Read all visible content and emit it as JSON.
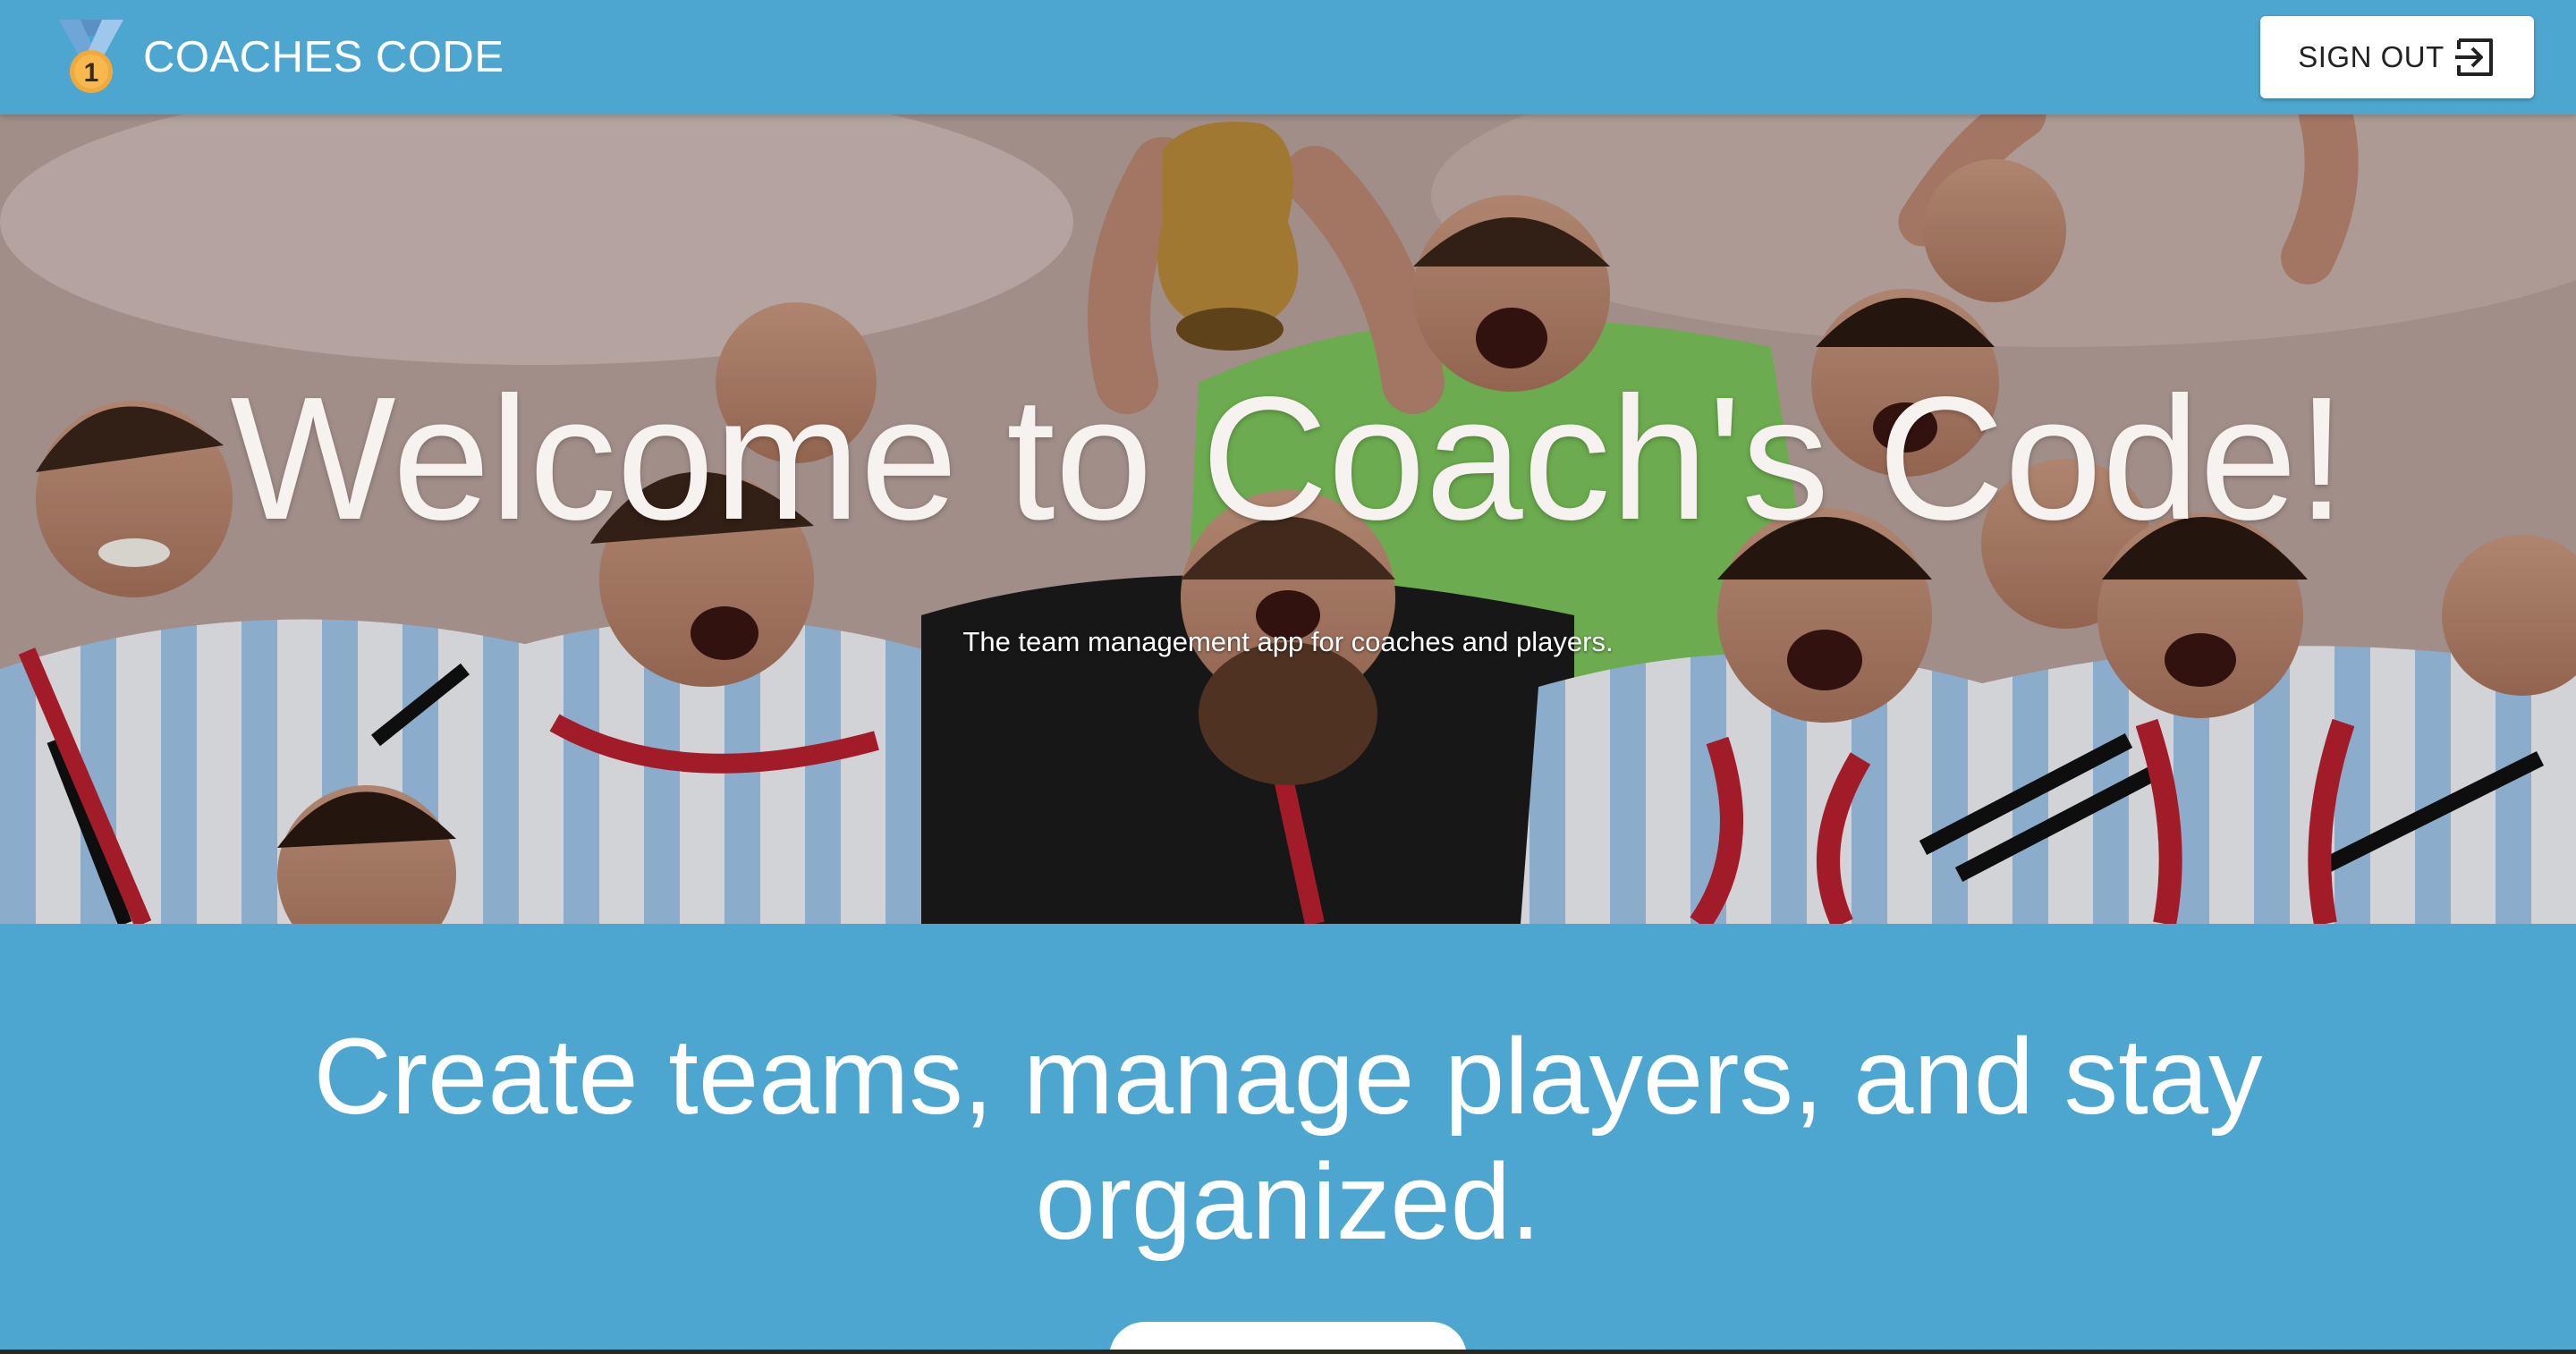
{
  "topbar": {
    "brand_name": "COACHES CODE",
    "logo_icon": "medal-first-place-icon",
    "medal_number": "1",
    "signout_label": "SIGN OUT",
    "signout_icon": "sign-out-icon"
  },
  "hero": {
    "title": "Welcome to Coach's Code!",
    "subtitle": "The team management app for coaches and players."
  },
  "feature": {
    "heading": "Create teams, manage players, and stay organized."
  },
  "colors": {
    "primary": "#4da6cf",
    "button_bg": "#ffffff",
    "text_light": "#ffffff",
    "text_dark": "#222222"
  }
}
